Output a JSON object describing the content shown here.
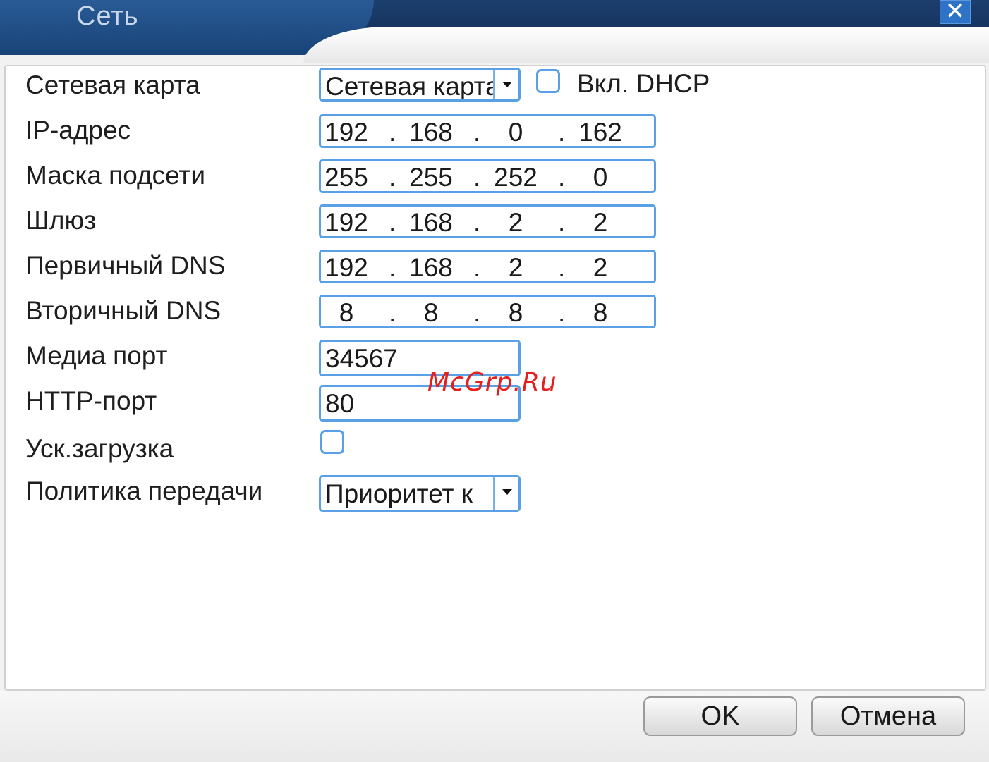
{
  "window": {
    "title": "Сеть",
    "close_label": "✕"
  },
  "form": {
    "network_card": {
      "label": "Сетевая карта",
      "value": "Сетевая карта"
    },
    "dhcp": {
      "label": "Вкл. DHCP",
      "checked": false
    },
    "ip": {
      "label": "IP-адрес",
      "octets": [
        "192",
        "168",
        "0",
        "162"
      ]
    },
    "mask": {
      "label": "Маска подсети",
      "octets": [
        "255",
        "255",
        "252",
        "0"
      ]
    },
    "gateway": {
      "label": "Шлюз",
      "octets": [
        "192",
        "168",
        "2",
        "2"
      ]
    },
    "dns1": {
      "label": "Первичный DNS",
      "octets": [
        "192",
        "168",
        "2",
        "2"
      ]
    },
    "dns2": {
      "label": "Вторичный DNS",
      "octets": [
        "8",
        "8",
        "8",
        "8"
      ]
    },
    "media_port": {
      "label": "Медиа порт",
      "value": "34567"
    },
    "http_port": {
      "label": "HTTP-порт",
      "value": "80"
    },
    "fast_download": {
      "label": "Уск.загрузка",
      "checked": false
    },
    "policy": {
      "label": "Политика передачи",
      "value": "Приоритет к"
    }
  },
  "watermark": "McGrp.Ru",
  "buttons": {
    "ok": "OK",
    "cancel": "Отмена"
  }
}
